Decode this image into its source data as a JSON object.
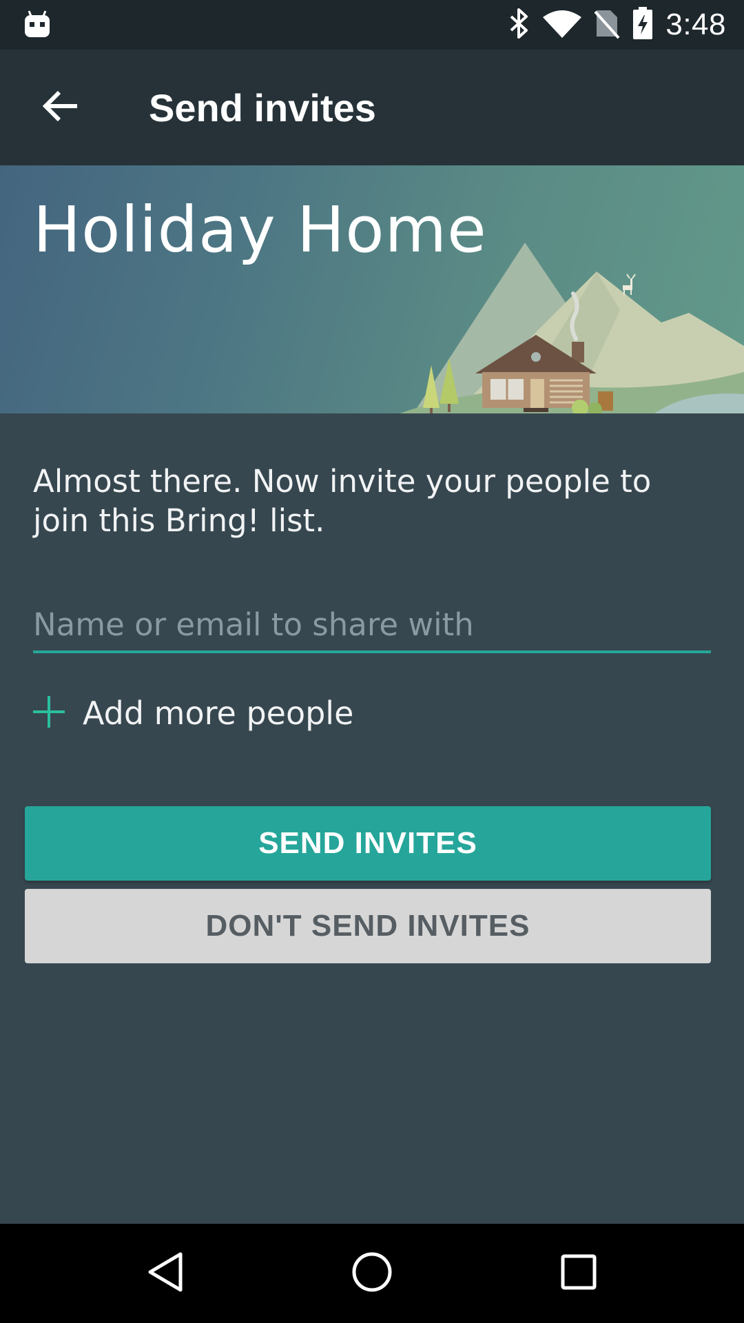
{
  "status_bar": {
    "time": "3:48",
    "icons": [
      "android-bot-icon",
      "bluetooth-icon",
      "wifi-icon",
      "no-sim-icon",
      "battery-charging-icon"
    ]
  },
  "app_bar": {
    "back_icon": "arrow-left-icon",
    "title": "Send invites"
  },
  "hero": {
    "list_name": "Holiday Home",
    "illustration": "mountain-house-illustration"
  },
  "content": {
    "intro_text": "Almost there. Now invite your people to join this Bring! list.",
    "input": {
      "placeholder": "Name or email to share with",
      "value": ""
    },
    "add_more_label": "Add more people",
    "send_button": "SEND INVITES",
    "dont_send_button": "DON'T SEND INVITES"
  },
  "nav_bar": {
    "icons": [
      "back-triangle-icon",
      "home-circle-icon",
      "recents-square-icon"
    ]
  },
  "colors": {
    "accent": "#26a69a",
    "background": "#37474f",
    "app_bar": "#263238",
    "secondary_button": "#d6d6d6"
  }
}
